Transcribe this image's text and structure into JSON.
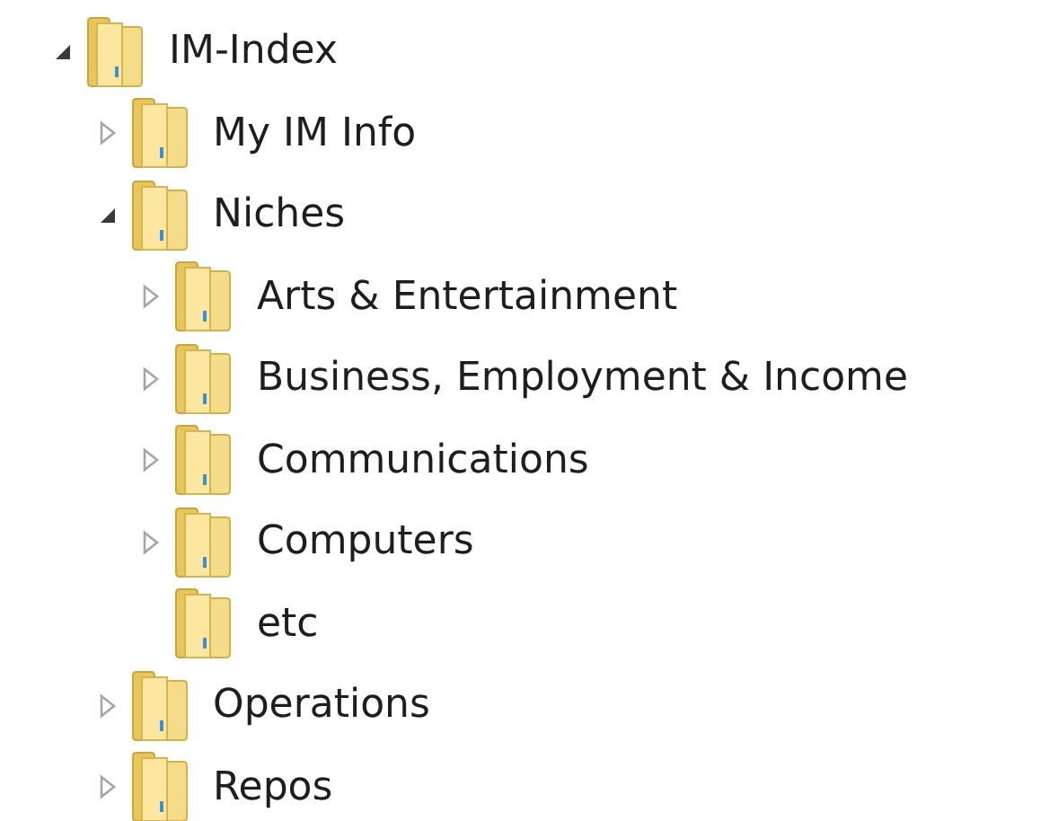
{
  "tree": [
    {
      "label": "IM-Index",
      "expandable": true,
      "expanded": true,
      "children": [
        {
          "label": "My IM Info",
          "expandable": true,
          "expanded": false
        },
        {
          "label": "Niches",
          "expandable": true,
          "expanded": true,
          "children": [
            {
              "label": "Arts & Entertainment",
              "expandable": true,
              "expanded": false
            },
            {
              "label": "Business, Employment & Income",
              "expandable": true,
              "expanded": false
            },
            {
              "label": "Communications",
              "expandable": true,
              "expanded": false
            },
            {
              "label": "Computers",
              "expandable": true,
              "expanded": false
            },
            {
              "label": "etc",
              "expandable": false
            }
          ]
        },
        {
          "label": "Operations",
          "expandable": true,
          "expanded": false
        },
        {
          "label": "Repos",
          "expandable": true,
          "expanded": false
        }
      ]
    }
  ]
}
